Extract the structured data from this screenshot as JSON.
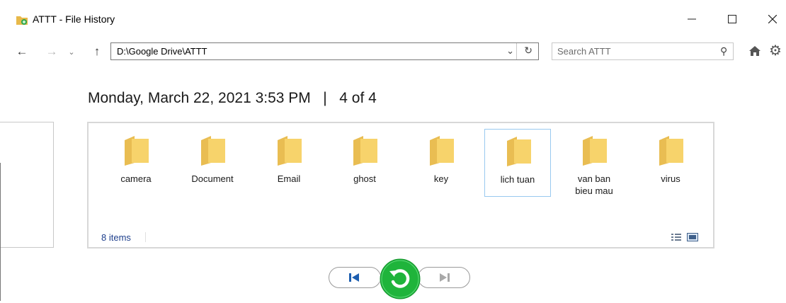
{
  "window": {
    "title": "ATTT - File History",
    "minimize_icon": "minimize-icon",
    "maximize_icon": "maximize-icon",
    "close_icon": "close-icon"
  },
  "nav": {
    "address": "D:\\Google Drive\\ATTT",
    "search_placeholder": "Search ATTT"
  },
  "snapshot": {
    "date_line": "Monday, March 22, 2021 3:53 PM   |   4 of 4"
  },
  "folders": [
    {
      "label": "camera"
    },
    {
      "label": "Document"
    },
    {
      "label": "Email"
    },
    {
      "label": "ghost"
    },
    {
      "label": "key"
    },
    {
      "label": "lich tuan",
      "selected": true
    },
    {
      "label": "van ban\nbieu mau"
    },
    {
      "label": "virus"
    }
  ],
  "status": {
    "items_count": "8 items"
  },
  "colors": {
    "accent_green": "#1fb43b",
    "folder_yellow": "#f7d36b",
    "selection_border": "#99c9ef",
    "status_text": "#1e3f8c"
  }
}
